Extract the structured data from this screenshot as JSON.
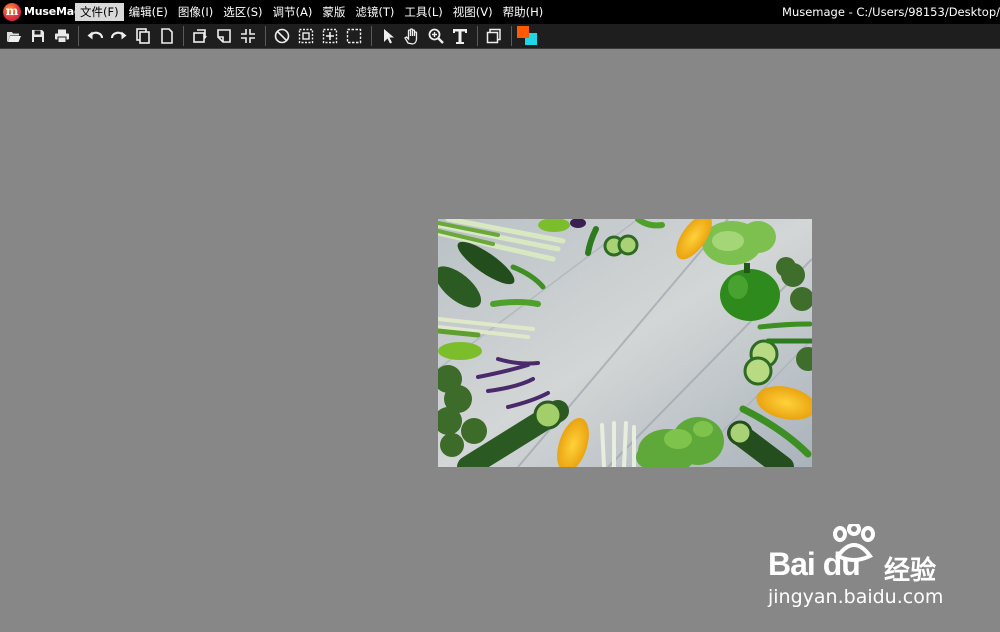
{
  "app": {
    "name": "MuseMage",
    "window_title": "Musemage - C:/Users/98153/Desktop/"
  },
  "menu": [
    {
      "label": "文件(F)",
      "active": true
    },
    {
      "label": "编辑(E)",
      "active": false
    },
    {
      "label": "图像(I)",
      "active": false
    },
    {
      "label": "选区(S)",
      "active": false
    },
    {
      "label": "调节(A)",
      "active": false
    },
    {
      "label": "蒙版",
      "active": false
    },
    {
      "label": "滤镜(T)",
      "active": false
    },
    {
      "label": "工具(L)",
      "active": false
    },
    {
      "label": "视图(V)",
      "active": false
    },
    {
      "label": "帮助(H)",
      "active": false
    }
  ],
  "toolbar": {
    "icons": [
      "open-icon",
      "save-icon",
      "print-icon",
      "undo-icon",
      "redo-icon",
      "copy-icon",
      "paste-icon",
      "rotate-icon",
      "flip-icon",
      "shrink-icon",
      "deselect-icon",
      "select-all-icon",
      "select-center-icon",
      "marquee-icon",
      "pointer-icon",
      "hand-icon",
      "zoom-icon",
      "text-icon",
      "layers-icon"
    ],
    "foreground_color": "#ff5a00",
    "background_color": "#1ed6e6"
  },
  "canvas": {
    "background": "#878787",
    "image_subject": "fresh-vegetables-on-wooden-table"
  },
  "watermark": {
    "brand": "Bai du",
    "cn": "经验",
    "url": "jingyan.baidu.com"
  }
}
